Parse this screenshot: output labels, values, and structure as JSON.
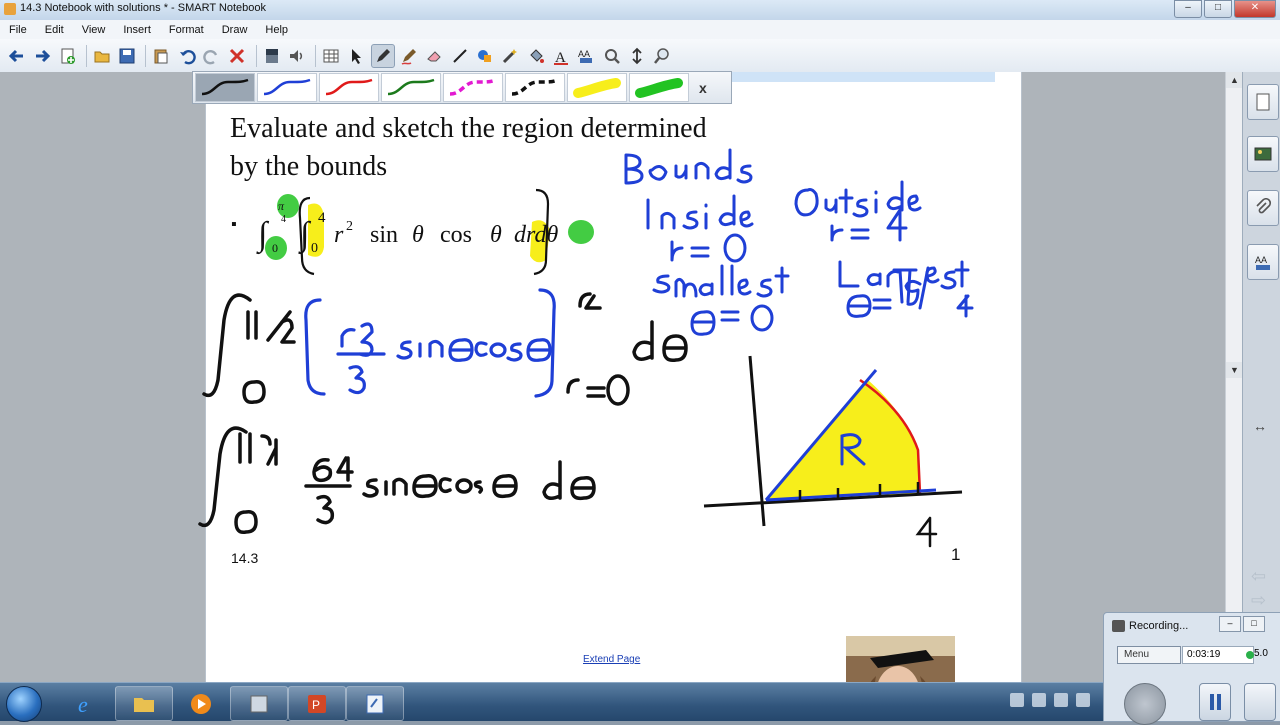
{
  "window": {
    "title": "14.3 Notebook with solutions * - SMART Notebook",
    "minimize": "–",
    "maximize": "□",
    "close": "✕"
  },
  "menu": [
    "File",
    "Edit",
    "View",
    "Insert",
    "Format",
    "Draw",
    "Help"
  ],
  "toolbar_icons": [
    "back-icon",
    "forward-icon",
    "add-page-icon",
    "open-icon",
    "save-icon",
    "paste-icon",
    "undo-icon",
    "redo-icon",
    "delete-icon",
    "screen-shade-icon",
    "sound-icon",
    "table-icon",
    "select-icon",
    "pen-icon",
    "creative-pen-icon",
    "eraser-icon",
    "line-icon",
    "shape-icon",
    "magic-pen-icon",
    "fill-icon",
    "text-icon",
    "properties-icon",
    "magnifier-icon",
    "move-icon",
    "zoom-icon"
  ],
  "pen_bar": {
    "pens": [
      {
        "name": "black-pen",
        "color": "#111111"
      },
      {
        "name": "blue-pen",
        "color": "#1f3fd6"
      },
      {
        "name": "red-pen",
        "color": "#e01a1a"
      },
      {
        "name": "green-pen",
        "color": "#1c7a1c"
      },
      {
        "name": "magenta-dashed-pen",
        "color": "#e21ad1"
      },
      {
        "name": "black-dashed-pen",
        "color": "#111111"
      },
      {
        "name": "yellow-highlighter",
        "color": "#f7ee1b"
      },
      {
        "name": "green-highlighter",
        "color": "#22c322"
      }
    ],
    "close_label": "x"
  },
  "page": {
    "question": "Evaluate and sketch the region determined by the bounds",
    "bullet": "▪",
    "page_label": "14.3",
    "page_number": "1",
    "extend_label": "Extend Page"
  },
  "recorder": {
    "title": "Recording...",
    "menu_label": "Menu",
    "elapsed": "0:03:19",
    "fps": "5.0"
  },
  "colors": {
    "ink_blue": "#1f3fd6",
    "ink_black": "#111111",
    "ink_red": "#e01a1a",
    "highlight_yellow": "#f7ee1b",
    "highlight_green": "#22c322"
  }
}
